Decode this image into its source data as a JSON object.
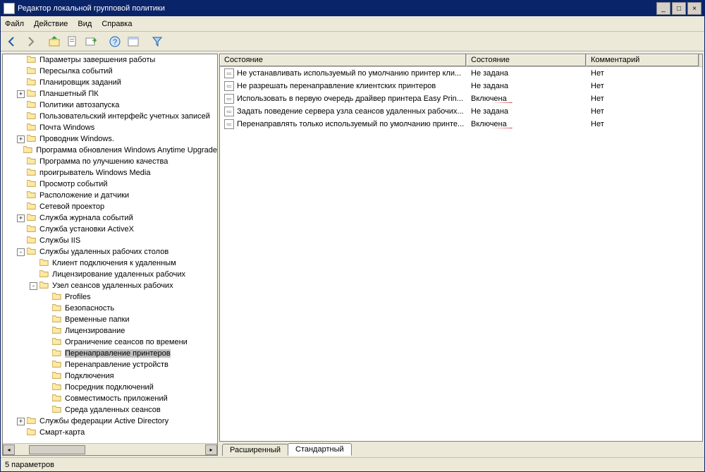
{
  "window_title": "Редактор локальной групповой политики",
  "menus": {
    "file": "Файл",
    "action": "Действие",
    "view": "Вид",
    "help": "Справка"
  },
  "tree": [
    {
      "indent": 5,
      "exp": null,
      "label": "Параметры завершения работы"
    },
    {
      "indent": 5,
      "exp": null,
      "label": "Пересылка событий"
    },
    {
      "indent": 5,
      "exp": null,
      "label": "Планировщик заданий"
    },
    {
      "indent": 5,
      "exp": "+",
      "label": "Планшетный ПК"
    },
    {
      "indent": 5,
      "exp": null,
      "label": "Политики автозапуска"
    },
    {
      "indent": 5,
      "exp": null,
      "label": "Пользовательский интерфейс учетных записей"
    },
    {
      "indent": 5,
      "exp": null,
      "label": "Почта Windows"
    },
    {
      "indent": 5,
      "exp": "+",
      "label": "Проводник Windows."
    },
    {
      "indent": 5,
      "exp": null,
      "label": "Программа обновления Windows Anytime Upgrade"
    },
    {
      "indent": 5,
      "exp": null,
      "label": "Программа по улучшению качества"
    },
    {
      "indent": 5,
      "exp": null,
      "label": "проигрыватель Windows Media"
    },
    {
      "indent": 5,
      "exp": null,
      "label": "Просмотр событий"
    },
    {
      "indent": 5,
      "exp": null,
      "label": "Расположение и датчики"
    },
    {
      "indent": 5,
      "exp": null,
      "label": "Сетевой проектор"
    },
    {
      "indent": 5,
      "exp": "+",
      "label": "Служба журнала событий"
    },
    {
      "indent": 5,
      "exp": null,
      "label": "Служба установки ActiveX"
    },
    {
      "indent": 5,
      "exp": null,
      "label": "Службы IIS"
    },
    {
      "indent": 5,
      "exp": "-",
      "label": "Службы удаленных рабочих столов"
    },
    {
      "indent": 6,
      "exp": null,
      "label": "Клиент подключения к удаленным"
    },
    {
      "indent": 6,
      "exp": null,
      "label": "Лицензирование удаленных рабочих"
    },
    {
      "indent": 6,
      "exp": "-",
      "label": "Узел сеансов удаленных рабочих"
    },
    {
      "indent": 7,
      "exp": null,
      "label": "Profiles"
    },
    {
      "indent": 7,
      "exp": null,
      "label": "Безопасность"
    },
    {
      "indent": 7,
      "exp": null,
      "label": "Временные папки"
    },
    {
      "indent": 7,
      "exp": null,
      "label": "Лицензирование"
    },
    {
      "indent": 7,
      "exp": null,
      "label": "Ограничение сеансов по времени"
    },
    {
      "indent": 7,
      "exp": null,
      "label": "Перенаправление принтеров",
      "selected": true
    },
    {
      "indent": 7,
      "exp": null,
      "label": "Перенаправление устройств"
    },
    {
      "indent": 7,
      "exp": null,
      "label": "Подключения"
    },
    {
      "indent": 7,
      "exp": null,
      "label": "Посредник подключений"
    },
    {
      "indent": 7,
      "exp": null,
      "label": "Совместимость приложений"
    },
    {
      "indent": 7,
      "exp": null,
      "label": "Среда удаленных сеансов"
    },
    {
      "indent": 5,
      "exp": "+",
      "label": "Службы федерации Active Directory"
    },
    {
      "indent": 5,
      "exp": null,
      "label": "Смарт-карта"
    }
  ],
  "list": {
    "headers": {
      "name": "Состояние",
      "state": "Состояние",
      "comment": "Комментарий"
    },
    "cols": {
      "name": 350,
      "state": 170,
      "comment": 160
    },
    "rows": [
      {
        "name": "Не устанавливать используемый по умолчанию принтер кли...",
        "state": "Не задана",
        "comment": "Нет",
        "underline": false
      },
      {
        "name": "Не разрешать перенаправление клиентских принтеров",
        "state": "Не задана",
        "comment": "Нет",
        "underline": false
      },
      {
        "name": "Использовать в первую очередь драйвер принтера Easy Prin...",
        "state": "Включена",
        "comment": "Нет",
        "underline": true
      },
      {
        "name": "Задать поведение сервера узла сеансов удаленных рабочих...",
        "state": "Не задана",
        "comment": "Нет",
        "underline": false
      },
      {
        "name": "Перенаправлять только используемый по умолчанию принте...",
        "state": "Включена",
        "comment": "Нет",
        "underline": true
      }
    ]
  },
  "tabs": {
    "extended": "Расширенный",
    "standard": "Стандартный"
  },
  "statusbar": "5 параметров"
}
